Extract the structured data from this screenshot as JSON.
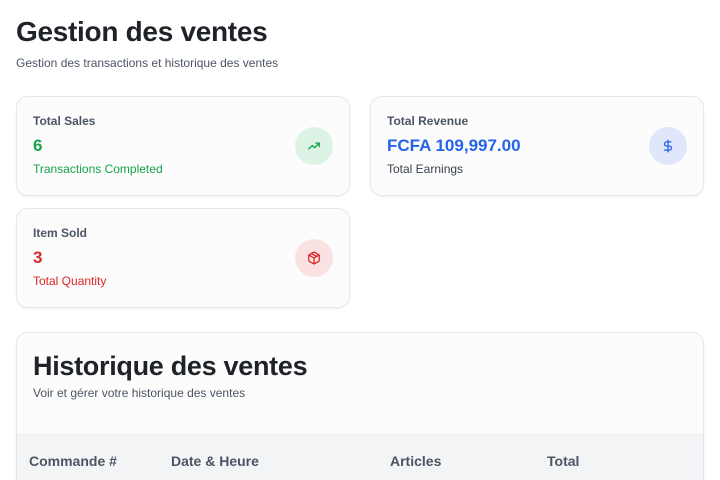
{
  "header": {
    "title": "Gestion des ventes",
    "subtitle": "Gestion des transactions et historique des ventes"
  },
  "stats": {
    "sales": {
      "label": "Total Sales",
      "value": "6",
      "sub": "Transactions Completed",
      "icon": "trending-up-icon",
      "color": "#16a34a"
    },
    "revenue": {
      "label": "Total Revenue",
      "value": "FCFA 109,997.00",
      "sub": "Total Earnings",
      "icon": "dollar-icon",
      "color": "#2563eb"
    },
    "items": {
      "label": "Item Sold",
      "value": "3",
      "sub": "Total Quantity",
      "icon": "package-icon",
      "color": "#dc2626"
    }
  },
  "history": {
    "title": "Historique des ventes",
    "subtitle": "Voir et gérer votre historique des ventes",
    "columns": [
      "Commande #",
      "Date & Heure",
      "Articles",
      "Total"
    ]
  }
}
